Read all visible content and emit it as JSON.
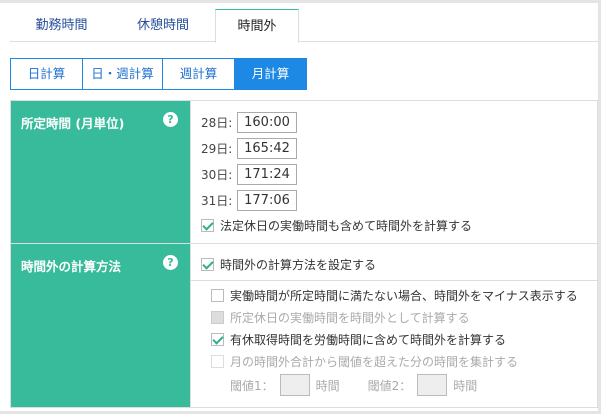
{
  "tabs": [
    "勤務時間",
    "休憩時間",
    "時間外"
  ],
  "calc_modes": [
    "日計算",
    "日・週計算",
    "週計算",
    "月計算"
  ],
  "section1": {
    "label": "所定時間 (月単位)",
    "help": "?",
    "rows": [
      {
        "label": "28日:",
        "value": "160:00"
      },
      {
        "label": "29日:",
        "value": "165:42"
      },
      {
        "label": "30日:",
        "value": "171:24"
      },
      {
        "label": "31日:",
        "value": "177:06"
      }
    ],
    "checkbox": "法定休日の実働時間も含めて時間外を計算する"
  },
  "section2": {
    "label": "時間外の計算方法",
    "help": "?",
    "main_checkbox": "時間外の計算方法を設定する",
    "options": [
      "実働時間が所定時間に満たない場合、時間外をマイナス表示する",
      "所定休日の実働時間を時間外として計算する",
      "有休取得時間を労働時間に含めて時間外を計算する",
      "月の時間外合計から閾値を超えた分の時間を集計する"
    ],
    "threshold1": "閾値1：",
    "threshold2": "閾値2：",
    "unit": "時間"
  }
}
